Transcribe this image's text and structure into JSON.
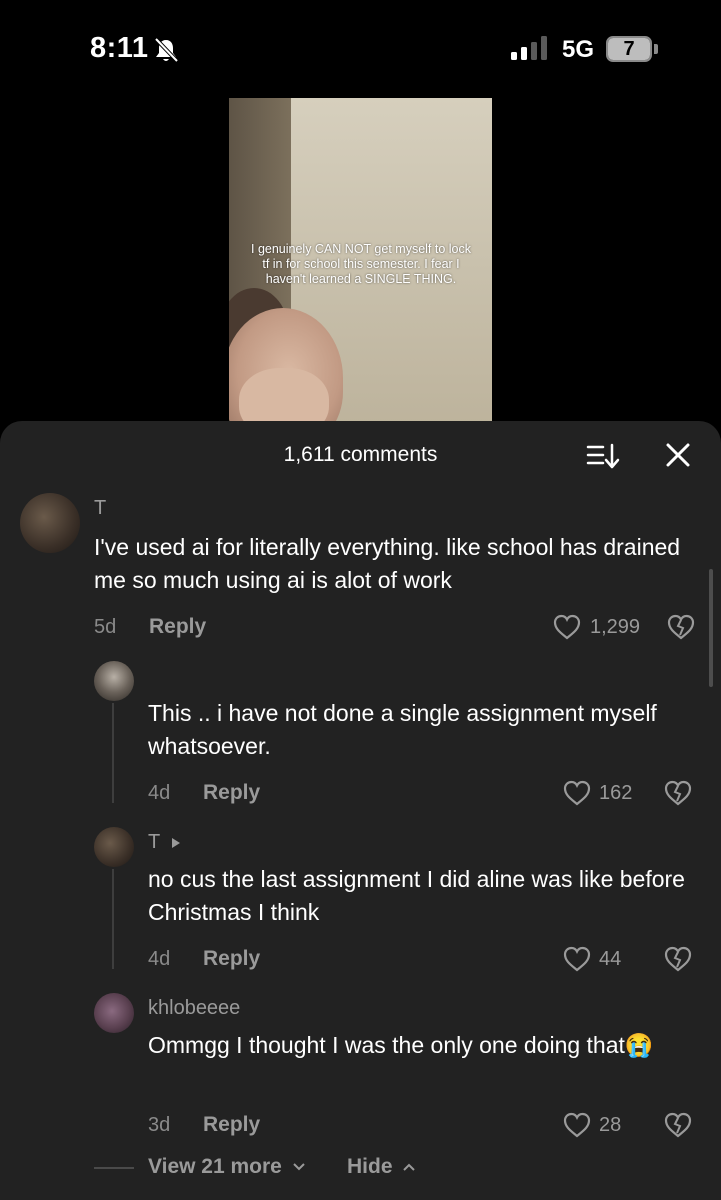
{
  "status_bar": {
    "time": "8:11",
    "network": "5G",
    "battery": "7"
  },
  "video": {
    "caption": "I genuinely CAN NOT get myself to lock tf in for school this semester. I fear I haven't learned a SINGLE THING."
  },
  "comments_panel": {
    "count_label": "1,611 comments",
    "comments": [
      {
        "username": "T",
        "text": "I've used ai for literally everything. like school has drained me so much using ai is alot of work",
        "age": "5d",
        "reply_label": "Reply",
        "likes": "1,299"
      },
      {
        "username": "",
        "text": "This .. i have not done a single assignment myself whatsoever.",
        "age": "4d",
        "reply_label": "Reply",
        "likes": "162"
      },
      {
        "username": "T",
        "text": "no cus the last assignment I did aline was like before Christmas I think",
        "age": "4d",
        "reply_label": "Reply",
        "likes": "44"
      },
      {
        "username": "khlobeeee",
        "text": "Ommgg I thought I was the only one doing that",
        "emoji": "😭",
        "age": "3d",
        "reply_label": "Reply",
        "likes": "28"
      }
    ],
    "view_more_label": "View 21 more",
    "hide_label": "Hide"
  },
  "colors": {
    "panel_bg": "#222222",
    "muted_text": "#9a9a9a",
    "primary_text": "#ffffff"
  }
}
